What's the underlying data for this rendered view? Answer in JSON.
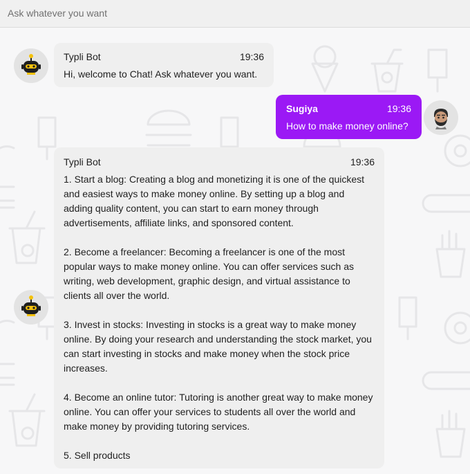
{
  "input": {
    "placeholder": "Ask whatever you want"
  },
  "messages": {
    "welcome": {
      "sender": "Typli Bot",
      "time": "19:36",
      "text": "Hi, welcome to Chat! Ask whatever you want."
    },
    "question": {
      "sender": "Sugiya",
      "time": "19:36",
      "text": "How to make money online?"
    },
    "answer": {
      "sender": "Typli Bot",
      "time": "19:36",
      "text": "1. Start a blog: Creating a blog and monetizing it is one of the quickest and easiest ways to make money online. By setting up a blog and adding quality content, you can start to earn money through advertisements, affiliate links, and sponsored content.\n\n2. Become a freelancer: Becoming a freelancer is one of the most popular ways to make money online. You can offer services such as writing, web development, graphic design, and virtual assistance to clients all over the world.\n\n3. Invest in stocks: Investing in stocks is a great way to make money online. By doing your research and understanding the stock market, you can start investing in stocks and make money when the stock price increases.\n\n4. Become an online tutor: Tutoring is another great way to make money online. You can offer your services to students all over the world and make money by providing tutoring services.\n\n5. Sell products"
    }
  },
  "colors": {
    "user_bubble": "#9b19f5",
    "bot_bubble": "#efefef",
    "background": "#f7f7f8"
  }
}
